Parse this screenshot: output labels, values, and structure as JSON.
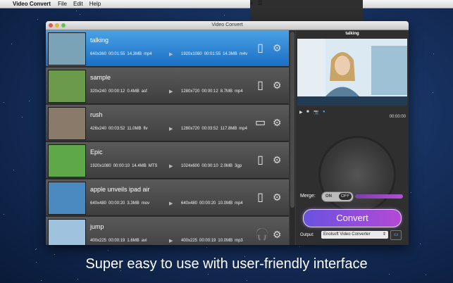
{
  "menubar": {
    "app_name": "Video Convert",
    "items": [
      "File",
      "Edit",
      "Help"
    ]
  },
  "window": {
    "title": "Video Convert"
  },
  "files": [
    {
      "name": "talking",
      "src": {
        "res": "640x360",
        "dur": "00:01:55",
        "size": "14.3MB",
        "fmt": "mp4"
      },
      "dst": {
        "res": "1920x1080",
        "dur": "00:01:55",
        "size": "14.3MB",
        "fmt": "m4v"
      },
      "device_icon": "ipad-icon",
      "selected": true,
      "thumb": "#7aa3b8"
    },
    {
      "name": "sample",
      "src": {
        "res": "320x240",
        "dur": "00:00:12",
        "size": "0.4MB",
        "fmt": "asf"
      },
      "dst": {
        "res": "1280x720",
        "dur": "00:00:12",
        "size": "8.7MB",
        "fmt": "mp4"
      },
      "device_icon": "iphone-icon",
      "selected": false,
      "thumb": "#6b9a4a"
    },
    {
      "name": "rush",
      "src": {
        "res": "426x240",
        "dur": "00:03:52",
        "size": "11.0MB",
        "fmt": "flv"
      },
      "dst": {
        "res": "1280x720",
        "dur": "00:03:52",
        "size": "117.8MB",
        "fmt": "mp4"
      },
      "device_icon": "apple-tv-icon",
      "selected": false,
      "thumb": "#8a7a6a"
    },
    {
      "name": "Epic",
      "src": {
        "res": "1920x1080",
        "dur": "00:00:10",
        "size": "14.4MB",
        "fmt": "MTS"
      },
      "dst": {
        "res": "1024x600",
        "dur": "00:00:10",
        "size": "2.0MB",
        "fmt": "3gp"
      },
      "device_icon": "tablet-icon",
      "selected": false,
      "thumb": "#5fa84a"
    },
    {
      "name": "apple unveils ipad air",
      "src": {
        "res": "640x480",
        "dur": "00:00:20",
        "size": "3.3MB",
        "fmt": "mov"
      },
      "dst": {
        "res": "640x480",
        "dur": "00:00:20",
        "size": "10.0MB",
        "fmt": "mp4"
      },
      "device_icon": "ipod-icon",
      "selected": false,
      "thumb": "#4a8ac0"
    },
    {
      "name": "jump",
      "src": {
        "res": "400x225",
        "dur": "00:00:19",
        "size": "1.6MB",
        "fmt": "avi"
      },
      "dst": {
        "res": "400x225",
        "dur": "00:00:19",
        "size": "10.0MB",
        "fmt": "mp3"
      },
      "device_icon": "headphones-icon",
      "selected": false,
      "thumb": "#9fc2de"
    }
  ],
  "preview": {
    "title": "talking",
    "timecode": "00:00:00"
  },
  "merge": {
    "label": "Merge:",
    "on_label": "ON",
    "off_label": "OFF"
  },
  "convert_label": "Convert",
  "output": {
    "label": "Output:",
    "value": "Enolsoft Video Converter"
  },
  "caption": "Super easy to use with user-friendly interface"
}
